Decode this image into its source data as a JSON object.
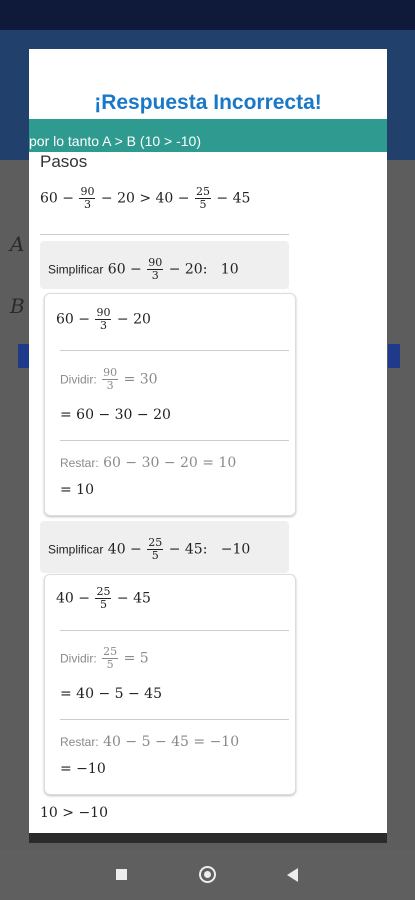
{
  "dialog": {
    "title": "¡Respuesta Incorrecta!",
    "teal_text": "por lo tanto A > B (10 > -10)",
    "steps_label": "Pasos"
  },
  "background": {
    "A": "A",
    "B": "B"
  },
  "expr": {
    "comparison": {
      "a": "60 − ",
      "fa": [
        "90",
        "3"
      ],
      "b": " − 20 > 40 − ",
      "fb": [
        "25",
        "5"
      ],
      "c": " − 45"
    },
    "s1_head": {
      "label": "Simplificar",
      "a": " 60 − ",
      "f": [
        "90",
        "3"
      ],
      "b": " − 20:",
      "result": "10"
    },
    "s1_expr": {
      "a": "60 − ",
      "f": [
        "90",
        "3"
      ],
      "b": " − 20"
    },
    "s1_divide": {
      "label": "Dividir:",
      "f": [
        "90",
        "3"
      ],
      "rest": " = 30"
    },
    "s1_eq1": "= 60 − 30 − 20",
    "s1_subtract": {
      "label": "Restar:",
      "rest": " 60 − 30 − 20 = 10"
    },
    "s1_eq2": "= 10",
    "s2_head": {
      "label": "Simplificar",
      "a": " 40 − ",
      "f": [
        "25",
        "5"
      ],
      "b": " − 45:",
      "result": "−10"
    },
    "s2_expr": {
      "a": "40 − ",
      "f": [
        "25",
        "5"
      ],
      "b": " − 45"
    },
    "s2_divide": {
      "label": "Dividir:",
      "f": [
        "25",
        "5"
      ],
      "rest": " = 5"
    },
    "s2_eq1": "= 40 − 5 − 45",
    "s2_subtract": {
      "label": "Restar:",
      "rest": " 40 − 5 − 45 = −10"
    },
    "s2_eq2": "= −10",
    "final": "10 > −10"
  },
  "colors": {
    "title": "#1a78c9",
    "teal": "#2e9a90",
    "appbar": "#21406b"
  },
  "icons": [
    "recents-square-icon",
    "home-circle-icon",
    "back-triangle-icon"
  ]
}
